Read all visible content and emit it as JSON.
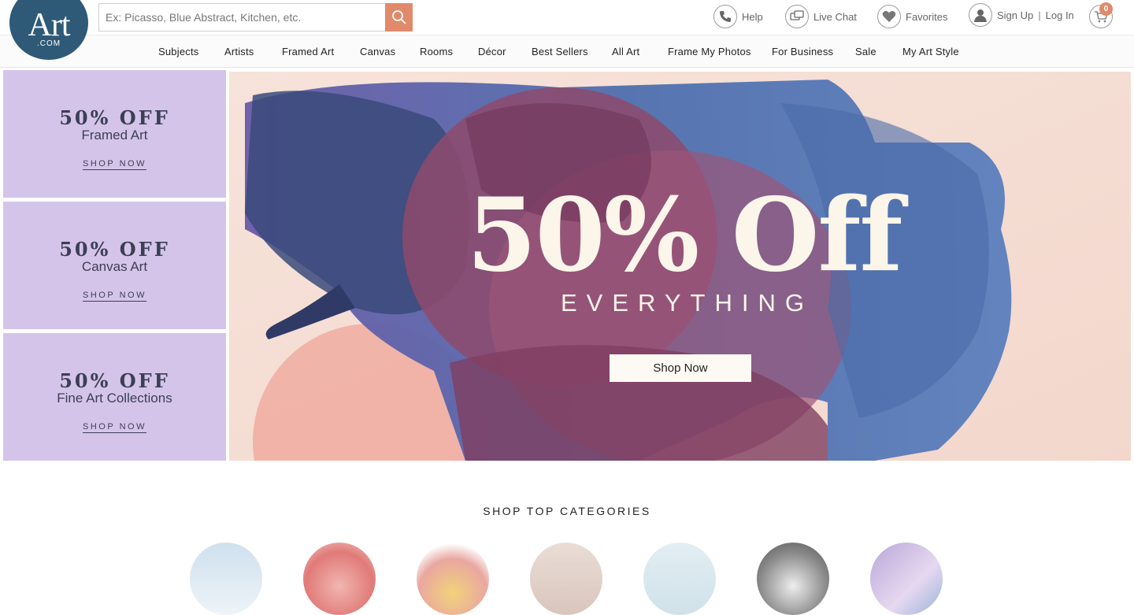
{
  "header": {
    "logo_main": "Art",
    "logo_sub": ".COM",
    "search_placeholder": "Ex: Picasso, Blue Abstract, Kitchen, etc.",
    "help": "Help",
    "live_chat": "Live Chat",
    "favorites": "Favorites",
    "sign_up": "Sign Up",
    "separator": "|",
    "log_in": "Log In",
    "cart_count": "0",
    "accent_color": "#e1896b",
    "logo_color": "#2e5a77"
  },
  "nav": {
    "items": [
      "Subjects",
      "Artists",
      "Framed Art",
      "Canvas",
      "Rooms",
      "Décor",
      "Best Sellers",
      "All Art",
      "Frame My Photos",
      "For Business",
      "Sale",
      "My Art Style"
    ]
  },
  "promos": [
    {
      "offer": "50% OFF",
      "label": "Framed Art",
      "cta": "SHOP NOW"
    },
    {
      "offer": "50% OFF",
      "label": "Canvas Art",
      "cta": "SHOP NOW"
    },
    {
      "offer": "50% OFF",
      "label": "Fine Art Collections",
      "cta": "SHOP NOW"
    }
  ],
  "hero": {
    "title": "50% Off",
    "subtitle": "EVERYTHING",
    "button": "Shop Now"
  },
  "categories": {
    "heading": "SHOP TOP CATEGORIES"
  }
}
